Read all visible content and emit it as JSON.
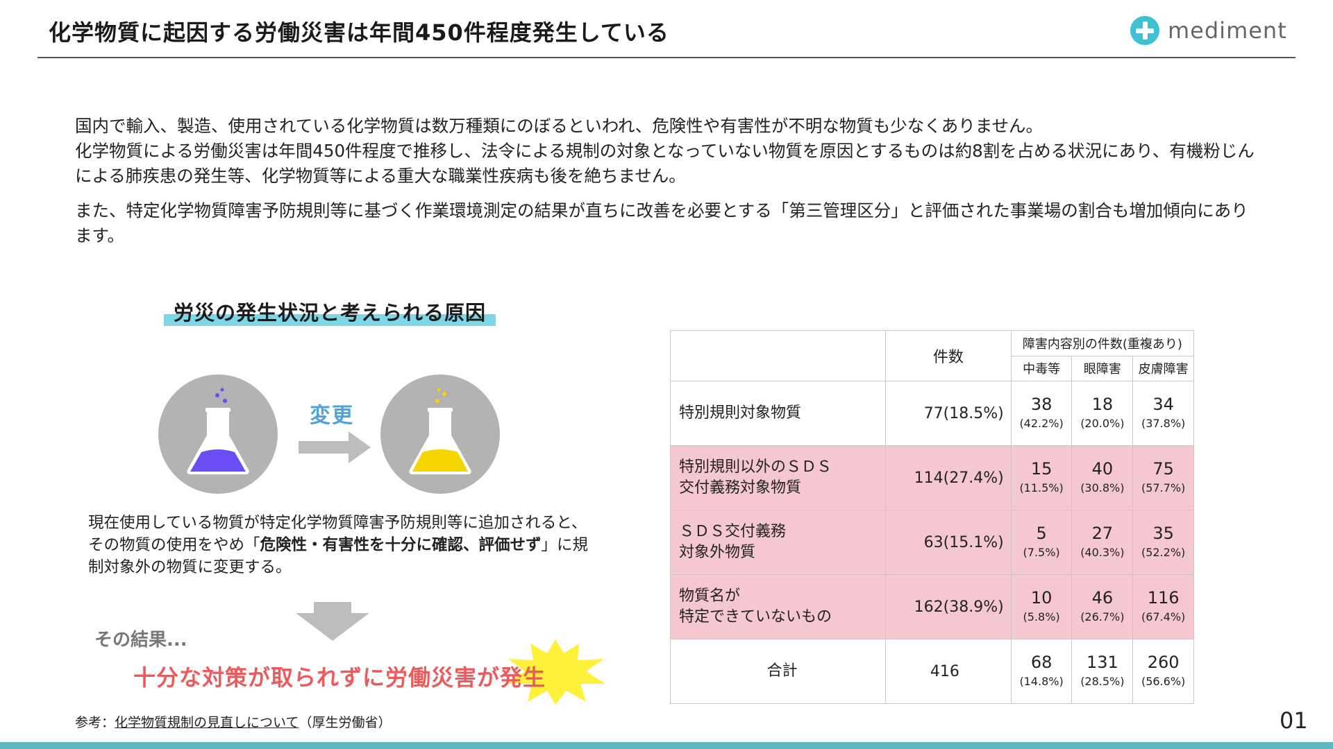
{
  "header": {
    "title": "化学物質に起因する労働災害は年間450件程度発生している",
    "brand": "mediment"
  },
  "intro": [
    "国内で輸入、製造、使用されている化学物質は数万種類にのぼるといわれ、危険性や有害性が不明な物質も少なくありません。",
    "化学物質による労働災害は年間450件程度で推移し、法令による規制の対象となっていない物質を原因とするものは約8割を占める状況にあり、有機粉じんによる肺疾患の発生等、化学物質等による重大な職業性疾病も後を絶ちません。",
    "また、特定化学物質障害予防規則等に基づく作業環境測定の結果が直ちに改善を必要とする「第三管理区分」と評価された事業場の割合も増加傾向にあります。"
  ],
  "diagram": {
    "section_title": "労災の発生状況と考えられる原因",
    "change_label": "変更",
    "flask_left_color": "#6a4cf2",
    "flask_right_color": "#f5d400",
    "description_pre": "現在使用している物質が特定化学物質障害予防規則等に追加されると、その物質の使用をやめ「",
    "description_bold": "危険性・有害性を十分に確認、評価せず",
    "description_post": "」に規制対象外の物質に変更する。",
    "result_label": "その結果...",
    "result_text": "十分な対策が取られずに労働災害が発生"
  },
  "table": {
    "header_count": "件数",
    "header_group": "障害内容別の件数(重複あり)",
    "header_cols": [
      "中毒等",
      "眼障害",
      "皮膚障害"
    ],
    "rows": [
      {
        "name": "特別規則対象物質",
        "count": "77(18.5%)",
        "cells": [
          {
            "v": "38",
            "p": "(42.2%)"
          },
          {
            "v": "18",
            "p": "(20.0%)"
          },
          {
            "v": "34",
            "p": "(37.8%)"
          }
        ]
      },
      {
        "name": "特別規則以外のＳＤＳ\n交付義務対象物質",
        "count": "114(27.4%)",
        "cells": [
          {
            "v": "15",
            "p": "(11.5%)"
          },
          {
            "v": "40",
            "p": "(30.8%)"
          },
          {
            "v": "75",
            "p": "(57.7%)"
          }
        ]
      },
      {
        "name": "ＳＤＳ交付義務\n対象外物質",
        "count": "63(15.1%)",
        "cells": [
          {
            "v": "5",
            "p": "(7.5%)"
          },
          {
            "v": "27",
            "p": "(40.3%)"
          },
          {
            "v": "35",
            "p": "(52.2%)"
          }
        ]
      },
      {
        "name": "物質名が\n特定できていないもの",
        "count": "162(38.9%)",
        "cells": [
          {
            "v": "10",
            "p": "(5.8%)"
          },
          {
            "v": "46",
            "p": "(26.7%)"
          },
          {
            "v": "116",
            "p": "(67.4%)"
          }
        ]
      },
      {
        "name": "合計",
        "count": "416",
        "cells": [
          {
            "v": "68",
            "p": "(14.8%)"
          },
          {
            "v": "131",
            "p": "(28.5%)"
          },
          {
            "v": "260",
            "p": "(56.6%)"
          }
        ]
      }
    ],
    "highlight_color": "#f5c7d1"
  },
  "footer": {
    "reference_prefix": "参考：",
    "reference_link": "化学物質規制の見直しについて",
    "reference_suffix": "（厚生労働省）",
    "page_number": "01"
  }
}
